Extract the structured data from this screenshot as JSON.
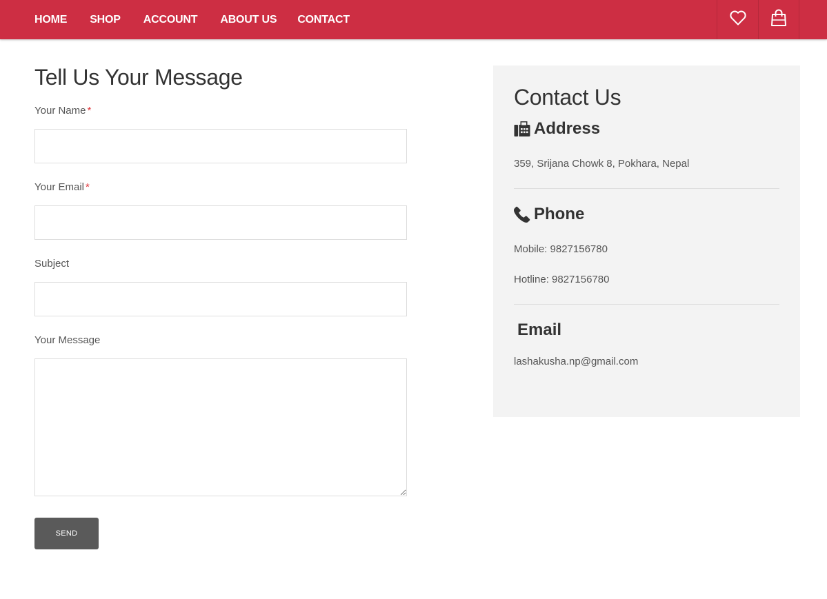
{
  "nav": {
    "links": [
      "HOME",
      "SHOP",
      "ACCOUNT",
      "ABOUT US",
      "CONTACT"
    ],
    "icons": [
      "heart-icon",
      "shopping-bag-icon"
    ],
    "bar_color": "#cd2e43"
  },
  "form": {
    "title": "Tell Us Your Message",
    "name_label": "Your Name",
    "email_label": "Your Email",
    "subject_label": "Subject",
    "message_label": "Your Message",
    "required_mark": "*",
    "name_value": "",
    "email_value": "",
    "subject_value": "",
    "message_value": "",
    "send_label": "SEND"
  },
  "contact": {
    "title": "Contact Us",
    "address_heading": "Address",
    "address": "359, Srijana Chowk 8, Pokhara, Nepal",
    "phone_heading": "Phone",
    "mobile": "Mobile: 9827156780",
    "hotline": "Hotline: 9827156780",
    "email_heading": "Email",
    "email": "lashakusha.np@gmail.com"
  }
}
